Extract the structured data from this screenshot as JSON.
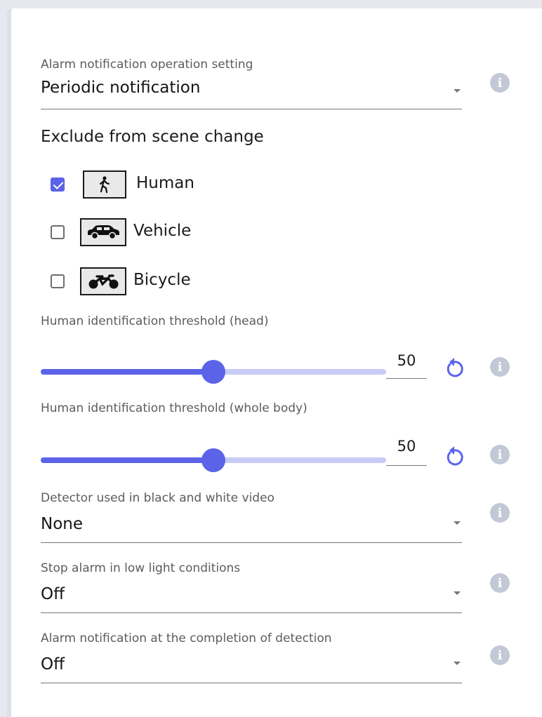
{
  "alarm_operation": {
    "label": "Alarm notification operation setting",
    "value": "Periodic notification",
    "info_icon": "info-icon"
  },
  "exclude": {
    "title": "Exclude from scene change",
    "items": [
      {
        "label": "Human",
        "checked": true,
        "icon": "pedestrian-icon"
      },
      {
        "label": "Vehicle",
        "checked": false,
        "icon": "car-icon"
      },
      {
        "label": "Bicycle",
        "checked": false,
        "icon": "bicycle-icon"
      }
    ]
  },
  "threshold_head": {
    "label": "Human identification threshold (head)",
    "value": "50",
    "slider_fraction": 0.5
  },
  "threshold_body": {
    "label": "Human identification threshold (whole body)",
    "value": "50",
    "slider_fraction": 0.5
  },
  "bw_detector": {
    "label": "Detector used in black and white video",
    "value": "None"
  },
  "low_light": {
    "label": "Stop alarm in low light conditions",
    "value": "Off"
  },
  "completion": {
    "label": "Alarm notification at the completion of detection",
    "value": "Off"
  },
  "colors": {
    "accent": "#5b63e8",
    "accent_light": "#c8cbf6",
    "info": "#c3c8d6"
  }
}
